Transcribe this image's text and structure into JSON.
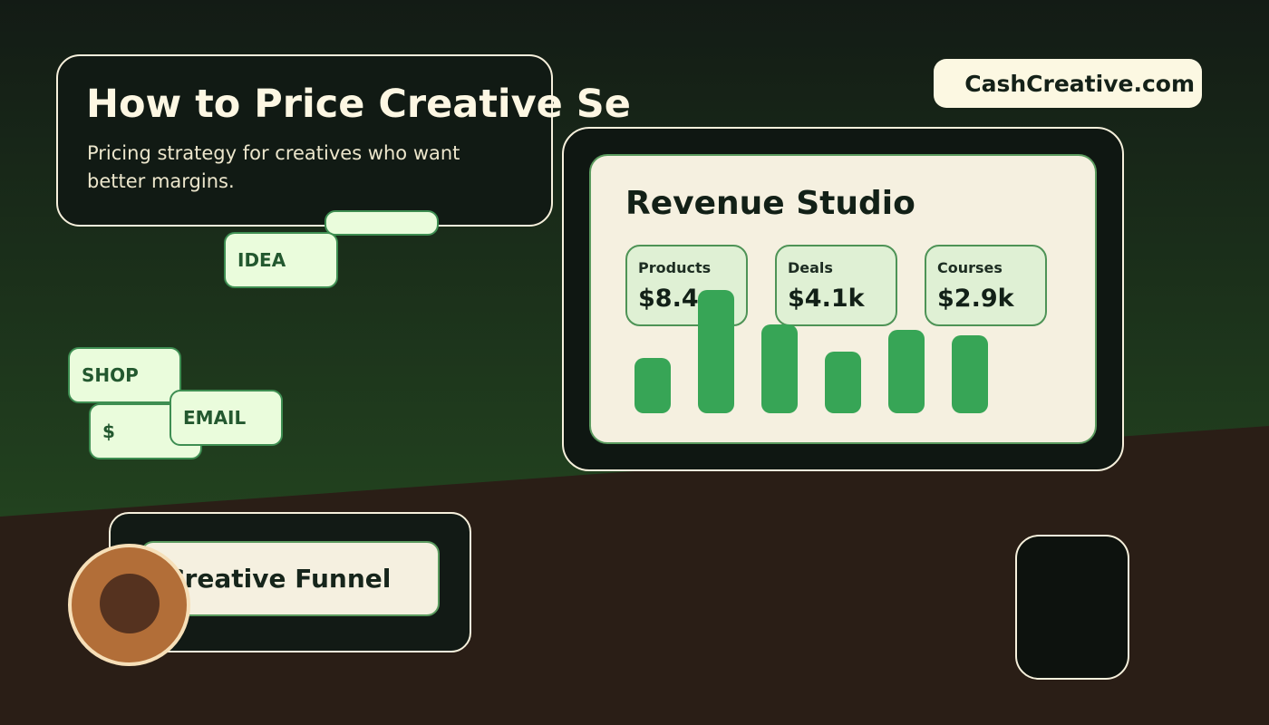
{
  "hero": {
    "title": "How to Price Creative Se",
    "subtitle": "Pricing strategy for creatives who want better margins."
  },
  "brand": {
    "label": "CashCreative.com"
  },
  "tags": {
    "idea": "IDEA",
    "shop": "SHOP",
    "money": "$",
    "email": "EMAIL"
  },
  "dashboard": {
    "title": "Revenue Studio",
    "stats": [
      {
        "label": "Products",
        "value": "$8.4"
      },
      {
        "label": "Deals",
        "value": "$4.1k"
      },
      {
        "label": "Courses",
        "value": "$2.9k"
      }
    ],
    "bar_levels": [
      0.45,
      1.0,
      0.72,
      0.5,
      0.68,
      0.63
    ]
  },
  "funnel": {
    "label": "Creative Funnel"
  },
  "colors": {
    "accent_green": "#37a556",
    "cream": "#f5f0e0",
    "dark": "#111a14",
    "coin": "#b26e38"
  }
}
